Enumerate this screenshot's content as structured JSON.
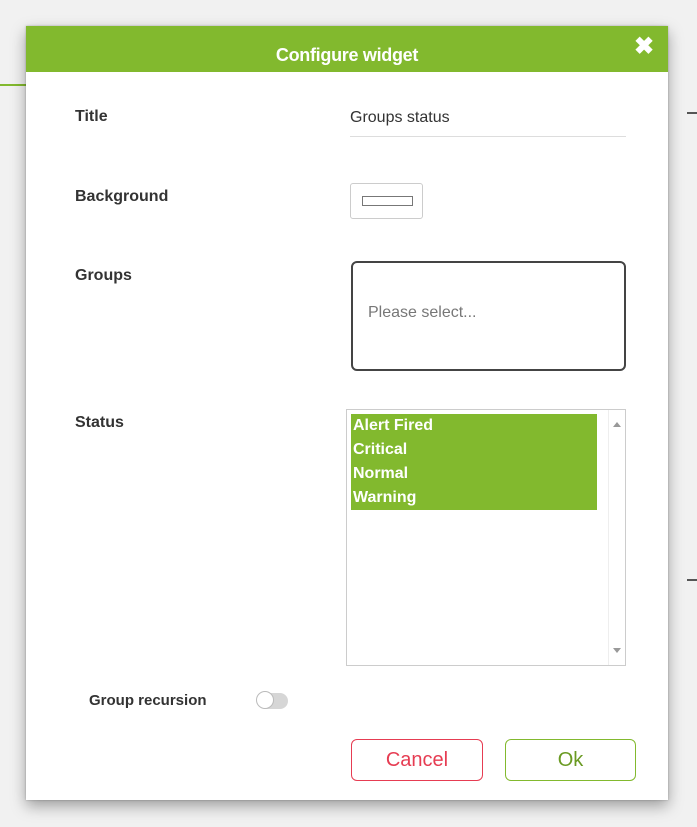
{
  "dialog": {
    "title": "Configure widget",
    "close_symbol": "✖"
  },
  "form": {
    "title_label": "Title",
    "title_value": "Groups status",
    "background_label": "Background",
    "background_color": "#ffffff",
    "groups_label": "Groups",
    "groups_placeholder": "Please select...",
    "status_label": "Status",
    "status_options": [
      "Alert Fired",
      "Critical",
      "Normal",
      "Warning"
    ],
    "group_recursion_label": "Group recursion",
    "group_recursion_on": false
  },
  "buttons": {
    "cancel_label": "Cancel",
    "ok_label": "Ok"
  },
  "colors": {
    "accent": "#82b92e",
    "cancel": "#e63c52"
  },
  "icons": {
    "close": "close-icon",
    "scroll_up": "chevron-up-icon",
    "scroll_down": "chevron-down-icon"
  }
}
